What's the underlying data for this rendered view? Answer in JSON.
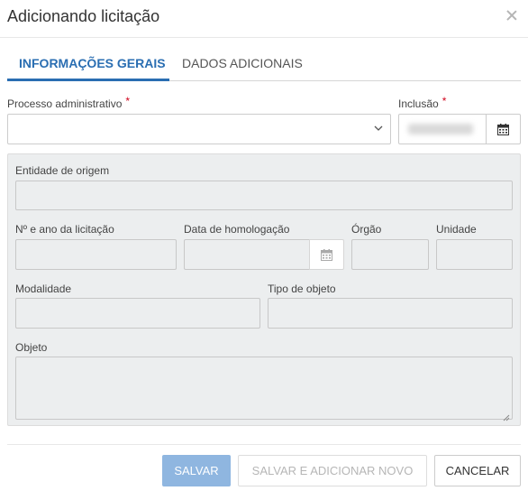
{
  "dialog": {
    "title": "Adicionando licitação"
  },
  "tabs": [
    {
      "label": "INFORMAÇÕES GERAIS",
      "active": true
    },
    {
      "label": "DADOS ADICIONAIS",
      "active": false
    }
  ],
  "form": {
    "processo_label": "Processo administrativo",
    "processo_value": "",
    "inclusao_label": "Inclusão",
    "required_mark": "*",
    "entidade_label": "Entidade de origem",
    "numero_label": "Nº e ano da licitação",
    "homologacao_label": "Data de homologação",
    "orgao_label": "Órgão",
    "unidade_label": "Unidade",
    "modalidade_label": "Modalidade",
    "tipo_objeto_label": "Tipo de objeto",
    "objeto_label": "Objeto"
  },
  "buttons": {
    "save": "SALVAR",
    "save_add_new": "SALVAR E ADICIONAR NOVO",
    "cancel": "CANCELAR"
  },
  "colors": {
    "accent": "#2a6eb2",
    "required": "#d0021b",
    "primary_disabled": "#8fb6e0",
    "panel_bg": "#eceeef"
  },
  "icons": {
    "close": "close-icon",
    "chevron": "chevron-down-icon",
    "calendar": "calendar-icon"
  }
}
